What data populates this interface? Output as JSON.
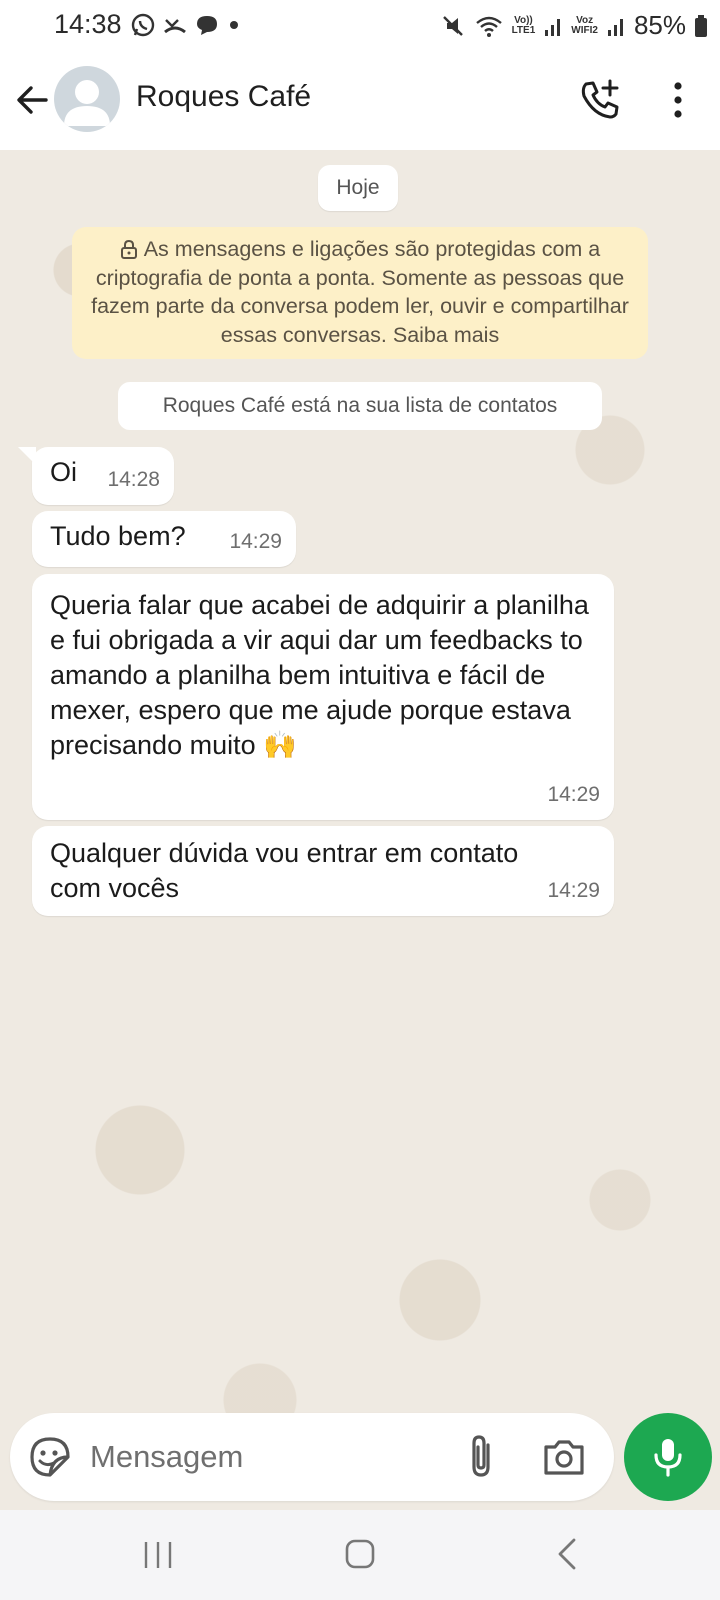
{
  "status_bar": {
    "time": "14:38",
    "battery": "85%",
    "net1": "Vo))\nLTE1",
    "net2": "Voz\nWIFI2"
  },
  "header": {
    "contact_name": "Roques Café"
  },
  "chat": {
    "date_label": "Hoje",
    "encryption_notice": "As mensagens e ligações são protegidas com a criptografia de ponta a ponta. Somente as pessoas que fazem parte da conversa podem ler, ouvir e compartilhar essas conversas. Saiba mais",
    "contact_notice": "Roques Café está na sua lista de contatos",
    "messages": [
      {
        "text": "Oi",
        "time": "14:28"
      },
      {
        "text": "Tudo bem?",
        "time": "14:29"
      },
      {
        "text": "Queria falar que acabei de adquirir a planilha e fui obrigada a vir aqui dar um feedbacks to amando a planilha bem intuitiva e fácil de mexer, espero que me ajude porque estava precisando muito 🙌",
        "time": "14:29"
      },
      {
        "text": "Qualquer dúvida vou entrar em contato com vocês",
        "time": "14:29"
      }
    ]
  },
  "composer": {
    "placeholder": "Mensagem"
  },
  "colors": {
    "accent": "#1da851",
    "chat_background": "#efeae2",
    "notice_background": "#fdf0c8"
  },
  "icons": {
    "back": "arrow-left-icon",
    "call": "phone-plus-icon",
    "menu": "more-vert-icon",
    "emoji": "sticker-icon",
    "attach": "paperclip-icon",
    "camera": "camera-icon",
    "mic": "microphone-icon"
  }
}
